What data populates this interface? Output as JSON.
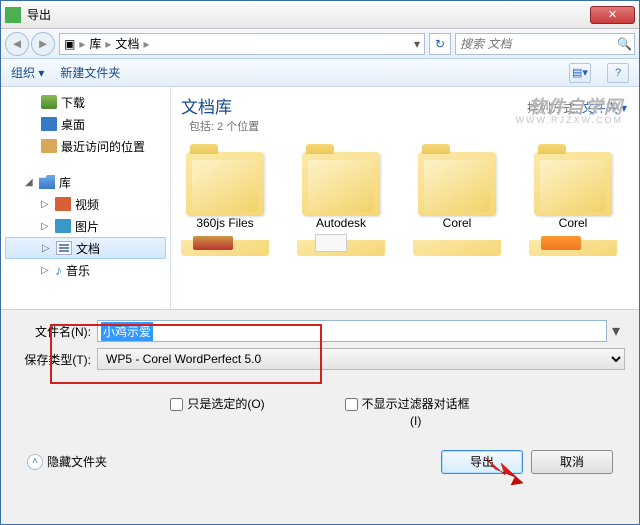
{
  "window": {
    "title": "导出"
  },
  "breadcrumb": {
    "seg1": "库",
    "seg2": "文档"
  },
  "search": {
    "placeholder": "搜索 文档"
  },
  "toolbar": {
    "organize": "组织",
    "newfolder": "新建文件夹"
  },
  "sidebar": {
    "downloads": "下载",
    "desktop": "桌面",
    "recent": "最近访问的位置",
    "libraries": "库",
    "videos": "视频",
    "pictures": "图片",
    "documents": "文档",
    "music": "音乐"
  },
  "main": {
    "title": "文档库",
    "subtitle": "包括: 2 个位置",
    "sort_label": "排列方式:",
    "sort_value": "文件夹",
    "folders": [
      "360js Files",
      "Autodesk",
      "Corel",
      "Corel"
    ]
  },
  "fields": {
    "filename_label": "文件名(N):",
    "filename_value": "小鸡示爱",
    "filetype_label": "保存类型(T):",
    "filetype_value": "WP5 - Corel WordPerfect 5.0"
  },
  "checks": {
    "selected_only": "只是选定的(O)",
    "no_filter_line1": "不显示过滤器对话框",
    "no_filter_line2": "(I)"
  },
  "footer": {
    "hide_folders": "隐藏文件夹",
    "export": "导出",
    "cancel": "取消"
  },
  "watermark": {
    "main": "软件自学网",
    "sub": "WWW.RJZXW.COM"
  }
}
